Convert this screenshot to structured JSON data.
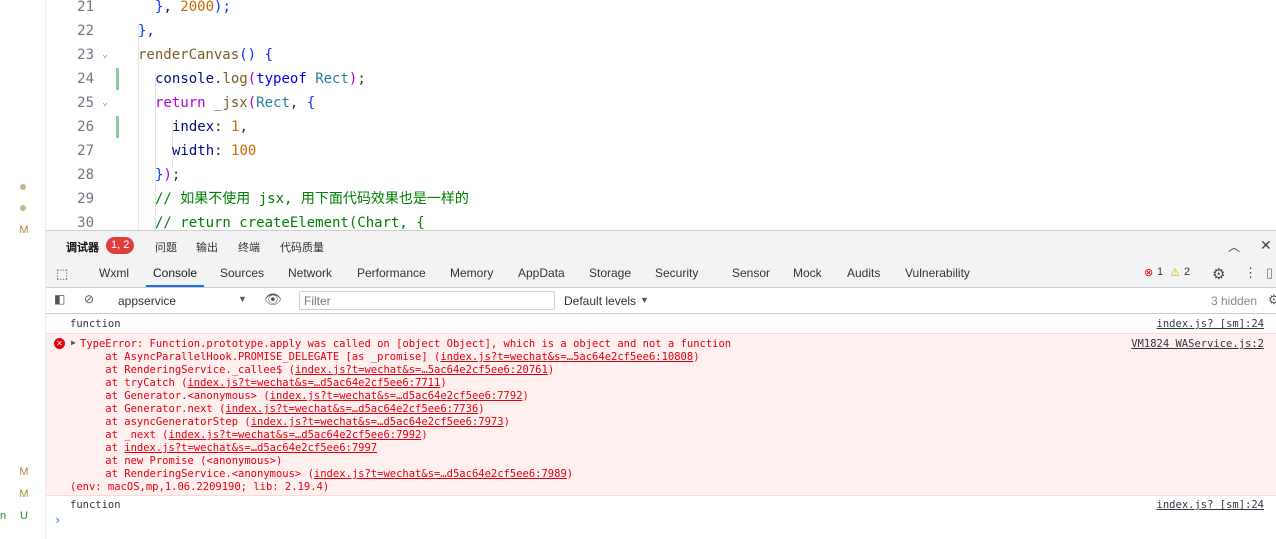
{
  "explorer": {
    "markers": [
      {
        "type": "dot"
      },
      {
        "type": "dot"
      },
      {
        "type": "letter",
        "text": "M"
      },
      {
        "type": "letter",
        "text": "M"
      },
      {
        "type": "letter",
        "text": "M"
      },
      {
        "type": "letter",
        "text": "U"
      }
    ],
    "cut_letter": "n"
  },
  "editor": {
    "lines": [
      {
        "n": "21",
        "indent": 2,
        "tokens": [
          {
            "c": "t-pun",
            "t": "}"
          },
          {
            "c": "t-id",
            "t": ", "
          },
          {
            "c": "t-num2",
            "t": "2000"
          },
          {
            "c": "t-pun",
            "t": ");"
          }
        ]
      },
      {
        "n": "22",
        "indent": 1,
        "tokens": [
          {
            "c": "t-pun",
            "t": "},"
          }
        ]
      },
      {
        "n": "23",
        "indent": 1,
        "fold": true,
        "tokens": [
          {
            "c": "t-fn",
            "t": "renderCanvas"
          },
          {
            "c": "t-pun",
            "t": "() {"
          }
        ]
      },
      {
        "n": "24",
        "indent": 2,
        "mod": true,
        "tokens": [
          {
            "c": "t-id",
            "t": "console"
          },
          {
            "c": "",
            "t": "."
          },
          {
            "c": "t-fn",
            "t": "log"
          },
          {
            "c": "t-brk",
            "t": "("
          },
          {
            "c": "t-ty",
            "t": "typeof"
          },
          {
            "c": "",
            "t": " "
          },
          {
            "c": "t-cls",
            "t": "Rect"
          },
          {
            "c": "t-brk",
            "t": ")"
          },
          {
            "c": "",
            "t": ";"
          }
        ]
      },
      {
        "n": "25",
        "indent": 2,
        "fold": true,
        "tokens": [
          {
            "c": "t-kw",
            "t": "return"
          },
          {
            "c": "",
            "t": " "
          },
          {
            "c": "t-fn",
            "t": "_jsx"
          },
          {
            "c": "t-brk",
            "t": "("
          },
          {
            "c": "t-cls",
            "t": "Rect"
          },
          {
            "c": "",
            "t": ", "
          },
          {
            "c": "t-pun",
            "t": "{"
          }
        ]
      },
      {
        "n": "26",
        "indent": 3,
        "mod": true,
        "tokens": [
          {
            "c": "t-id",
            "t": "index"
          },
          {
            "c": "",
            "t": ": "
          },
          {
            "c": "t-num2",
            "t": "1"
          },
          {
            "c": "",
            "t": ","
          }
        ]
      },
      {
        "n": "27",
        "indent": 3,
        "tokens": [
          {
            "c": "t-id",
            "t": "width"
          },
          {
            "c": "",
            "t": ": "
          },
          {
            "c": "t-num2",
            "t": "100"
          }
        ]
      },
      {
        "n": "28",
        "indent": 2,
        "tokens": [
          {
            "c": "t-pun",
            "t": "}"
          },
          {
            "c": "t-brk",
            "t": ")"
          },
          {
            "c": "",
            "t": ";"
          }
        ]
      },
      {
        "n": "29",
        "indent": 2,
        "tokens": [
          {
            "c": "t-cm",
            "t": "// 如果不使用 jsx, 用下面代码效果也是一样的"
          }
        ]
      },
      {
        "n": "30",
        "indent": 2,
        "tokens": [
          {
            "c": "t-cm",
            "t": "// return createElement(Chart, {"
          }
        ]
      }
    ]
  },
  "panel_tabs": {
    "debugger": "调试器",
    "badge": "1, 2",
    "issues": "问题",
    "output": "输出",
    "terminal": "终端",
    "quality": "代码质量"
  },
  "devtools_tabs": [
    "Wxml",
    "Console",
    "Sources",
    "Network",
    "Performance",
    "Memory",
    "AppData",
    "Storage",
    "Security",
    "Sensor",
    "Mock",
    "Audits",
    "Vulnerability"
  ],
  "active_tab": "Console",
  "counts": {
    "errors": "1",
    "warnings": "2"
  },
  "filterbar": {
    "context": "appservice",
    "filter_placeholder": "Filter",
    "levels": "Default levels",
    "hidden": "3 hidden"
  },
  "console": {
    "msg1": {
      "text": "function",
      "source": "index.js? [sm]:24"
    },
    "error": {
      "title": "TypeError: Function.prototype.apply was called on [object Object], which is a object and not a function",
      "source": "VM1824 WAService.js:2",
      "stack": [
        {
          "pre": "    at AsyncParallelHook.PROMISE_DELEGATE [as _promise] (",
          "link": "index.js?t=wechat&s=…5ac64e2cf5ee6:10808",
          "post": ")"
        },
        {
          "pre": "    at RenderingService._callee$ (",
          "link": "index.js?t=wechat&s=…5ac64e2cf5ee6:20761",
          "post": ")"
        },
        {
          "pre": "    at tryCatch (",
          "link": "index.js?t=wechat&s=…d5ac64e2cf5ee6:7711",
          "post": ")"
        },
        {
          "pre": "    at Generator.<anonymous> (",
          "link": "index.js?t=wechat&s=…d5ac64e2cf5ee6:7792",
          "post": ")"
        },
        {
          "pre": "    at Generator.next (",
          "link": "index.js?t=wechat&s=…d5ac64e2cf5ee6:7736",
          "post": ")"
        },
        {
          "pre": "    at asyncGeneratorStep (",
          "link": "index.js?t=wechat&s=…d5ac64e2cf5ee6:7973",
          "post": ")"
        },
        {
          "pre": "    at _next (",
          "link": "index.js?t=wechat&s=…d5ac64e2cf5ee6:7992",
          "post": ")"
        },
        {
          "pre": "    at ",
          "link": "index.js?t=wechat&s=…d5ac64e2cf5ee6:7997",
          "post": ""
        },
        {
          "pre": "    at new Promise (<anonymous>)",
          "link": "",
          "post": ""
        },
        {
          "pre": "    at RenderingService.<anonymous> (",
          "link": "index.js?t=wechat&s=…d5ac64e2cf5ee6:7989",
          "post": ")"
        }
      ],
      "env": "(env: macOS,mp,1.06.2209190; lib: 2.19.4)"
    },
    "msg2": {
      "text": "function",
      "source": "index.js? [sm]:24"
    },
    "prompt": "›"
  }
}
